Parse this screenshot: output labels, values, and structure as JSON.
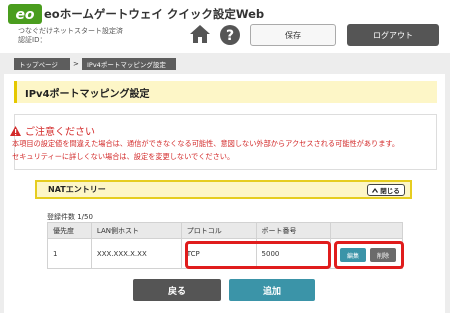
{
  "header": {
    "logo_text": "eo",
    "brand_tagline": "ホームゲートウェイ",
    "title": "eoホームゲートウェイ クイック設定Web",
    "subtitle": "つなぐだけネットスタート設定済",
    "id_label": "認証ID：",
    "save_label": "保存",
    "logout_label": "ログアウト"
  },
  "breadcrumb": {
    "items": [
      "トップページ",
      "IPv4ポートマッピング設定"
    ],
    "separator": ">"
  },
  "page_title": "IPv4ポートマッピング設定",
  "caution": {
    "heading": "ご注意ください",
    "line1": "本項目の設定値を間違えた場合は、通信ができなくなる可能性、意図しない外部からアクセスされる可能性があります。",
    "line2": "セキュリティーに詳しくない場合は、設定を変更しないでください。"
  },
  "nat": {
    "title": "NATエントリー",
    "close_label": "閉じる",
    "count_text": "登録件数 1/50",
    "columns": [
      "優先度",
      "LAN側ホスト",
      "プロトコル",
      "ポート番号",
      ""
    ],
    "rows": [
      {
        "priority": "1",
        "lan_host": "XXX.XXX.X.XX",
        "protocol": "TCP",
        "port": "5000",
        "edit_label": "編集",
        "delete_label": "削除"
      }
    ]
  },
  "footer": {
    "back_label": "戻る",
    "add_label": "追加"
  },
  "colors": {
    "brand_green": "#4a9d1e",
    "teal": "#3b94a8",
    "dark": "#555555",
    "warning_red": "#d32a2a",
    "highlight_red": "#e01c1c",
    "title_yellow": "#fdf6c7"
  }
}
